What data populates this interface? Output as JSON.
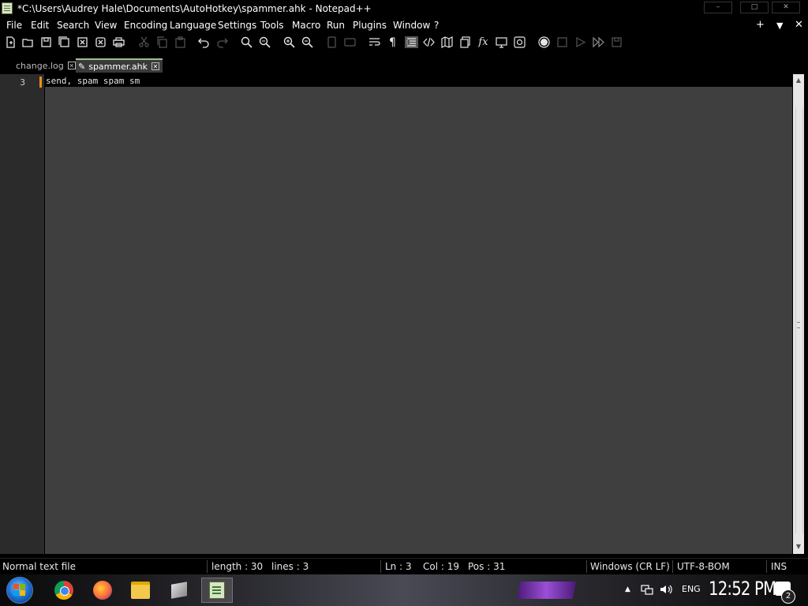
{
  "window": {
    "title": "*C:\\Users\\Audrey Hale\\Documents\\AutoHotkey\\spammer.ahk - Notepad++",
    "buttons": {
      "minimize": "–",
      "maximize": "□",
      "close": "✕"
    }
  },
  "menu": {
    "items": [
      "File",
      "Edit",
      "Search",
      "View",
      "Encoding",
      "Language",
      "Settings",
      "Tools",
      "Macro",
      "Run",
      "Plugins",
      "Window",
      "?"
    ],
    "right": {
      "plus": "+",
      "down": "▼",
      "close": "✕"
    }
  },
  "toolbar": {
    "icons": [
      "new-file-icon",
      "open-file-icon",
      "save-icon",
      "save-all-icon",
      "close-icon",
      "close-all-icon",
      "print-icon",
      "cut-icon",
      "copy-icon",
      "paste-icon",
      "undo-icon",
      "redo-icon",
      "find-icon",
      "replace-icon",
      "zoom-in-icon",
      "zoom-out-icon",
      "sync-vertical-icon",
      "sync-horizontal-icon",
      "word-wrap-icon",
      "show-all-characters-icon",
      "indent-guide-icon",
      "xml-tag-icon",
      "document-map-icon",
      "document-list-icon",
      "function-list-icon",
      "folder-as-workspace-icon",
      "monitoring-icon",
      "record-macro-icon",
      "stop-recording-icon",
      "playback-icon",
      "run-macro-multiple-icon",
      "save-macro-icon"
    ]
  },
  "tabs": [
    {
      "label": "change.log",
      "active": false
    },
    {
      "label": "spammer.ahk",
      "active": true
    }
  ],
  "editor": {
    "line_number": "3",
    "code": "send, spam spam sm"
  },
  "status": {
    "file_type": "Normal text file",
    "length": "length : 30",
    "lines": "lines : 3",
    "ln": "Ln : 3",
    "col": "Col : 19",
    "pos": "Pos : 31",
    "eol": "Windows (CR LF)",
    "encoding": "UTF-8-BOM",
    "mode": "INS"
  },
  "taskbar": {
    "apps": [
      "start-orb",
      "chrome-icon",
      "firefox-icon",
      "explorer-icon",
      "generic-app-icon",
      "notepadpp-icon"
    ],
    "tray": {
      "show_hidden": "▲",
      "language": "ENG",
      "clock": "12:52 PM",
      "notifications": "2"
    }
  },
  "colors": {
    "accent_orange": "#f28c1a",
    "editor_bg": "#3f3f3f",
    "gutter_bg": "#2b2b2b",
    "tray_purple": "#9b4fd6"
  }
}
